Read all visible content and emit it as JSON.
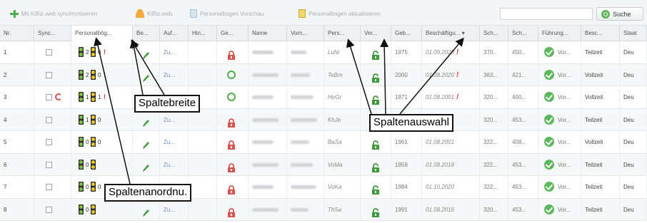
{
  "toolbar": {
    "sync_label": "Mit KiBiz.web synchronisieren",
    "kibiz_label": "KiBiz.web",
    "vorschau_label": "Personalbogen Vorschau",
    "aktualisieren_label": "Personalbogen aktualisieren",
    "search_placeholder": "",
    "search_button": "Suche"
  },
  "columns": [
    "Nr.",
    "Sync...",
    "Personalbög...",
    "Be...",
    "Auf...",
    "Hin...",
    "Ge...",
    "Name",
    "Vorn...",
    "Pers...",
    "Ver...",
    "Geb...",
    "Beschäftigu... ▾",
    "Sch...",
    "Sch...",
    "Führung...",
    "Besc...",
    "Staat"
  ],
  "rows": [
    {
      "nr": "1",
      "pnum": "2",
      "pnum2": "0",
      "auf": "Zu...",
      "kuerzel": "LuNi",
      "geb": "1975",
      "beschaeftigung": "01.09.2020",
      "sch1": "370...",
      "sch2": "450...",
      "fuehrung": "Vor...",
      "besc": "Teilzeit",
      "staat": "Deu"
    },
    {
      "nr": "2",
      "pnum": "2",
      "pnum2": "0",
      "auf": "Zu...",
      "kuerzel": "TeBm",
      "geb": "2000",
      "beschaeftigung": "01.08.2020",
      "sch1": "363...",
      "sch2": "421...",
      "fuehrung": "Vor...",
      "besc": "Vollzeit",
      "staat": "Deu"
    },
    {
      "nr": "3",
      "pnum": "1",
      "pnum2": "1",
      "auf": "Zu...",
      "kuerzel": "HeGr",
      "geb": "1971",
      "beschaeftigung": "01.08.2001",
      "sch1": "320...",
      "sch2": "400...",
      "fuehrung": "Vor...",
      "besc": "Vollzeit",
      "staat": "Deu"
    },
    {
      "nr": "4",
      "pnum": "1",
      "pnum2": "0",
      "auf": "Zu...",
      "kuerzel": "KhJe",
      "geb": "",
      "beschaeftigung": "",
      "sch1": "320...",
      "sch2": "453...",
      "fuehrung": "Vor...",
      "besc": "Teilzeit",
      "staat": "Deu"
    },
    {
      "nr": "5",
      "pnum": "0",
      "pnum2": "0",
      "auf": "Zu...",
      "kuerzel": "BaSa",
      "geb": "1961",
      "beschaeftigung": "01.08.2001",
      "sch1": "322...",
      "sch2": "408...",
      "fuehrung": "Vor...",
      "besc": "Vollzeit",
      "staat": "Deu"
    },
    {
      "nr": "6",
      "pnum": "0",
      "pnum2": "",
      "auf": "Zu...",
      "kuerzel": "VoMa",
      "geb": "1959",
      "beschaeftigung": "01.08.2016",
      "sch1": "322...",
      "sch2": "453...",
      "fuehrung": "Vor...",
      "besc": "Teilzeit",
      "staat": "Deu"
    },
    {
      "nr": "7",
      "pnum": "0",
      "pnum2": "0",
      "auf": "Zu...",
      "kuerzel": "VoKa",
      "geb": "1984",
      "beschaeftigung": "01.10.2020",
      "sch1": "322...",
      "sch2": "453...",
      "fuehrung": "Vor...",
      "besc": "Teilzeit",
      "staat": "Deu"
    },
    {
      "nr": "8",
      "pnum": "0",
      "pnum2": "",
      "auf": "Zu...",
      "kuerzel": "ThSa",
      "geb": "1991",
      "beschaeftigung": "01.08.2016",
      "sch1": "320...",
      "sch2": "453...",
      "fuehrung": "Vor...",
      "besc": "Teilzeit",
      "staat": "Deu"
    }
  ],
  "annotations": {
    "spaltebreite": "Spaltebreite",
    "spaltenauswahl": "Spaltenauswahl",
    "spaltenanordnung": "Spaltenanordnu."
  },
  "colors": {
    "warning": "#d9332e",
    "ok": "#5cb85c",
    "lock_red": "#d9534f"
  }
}
